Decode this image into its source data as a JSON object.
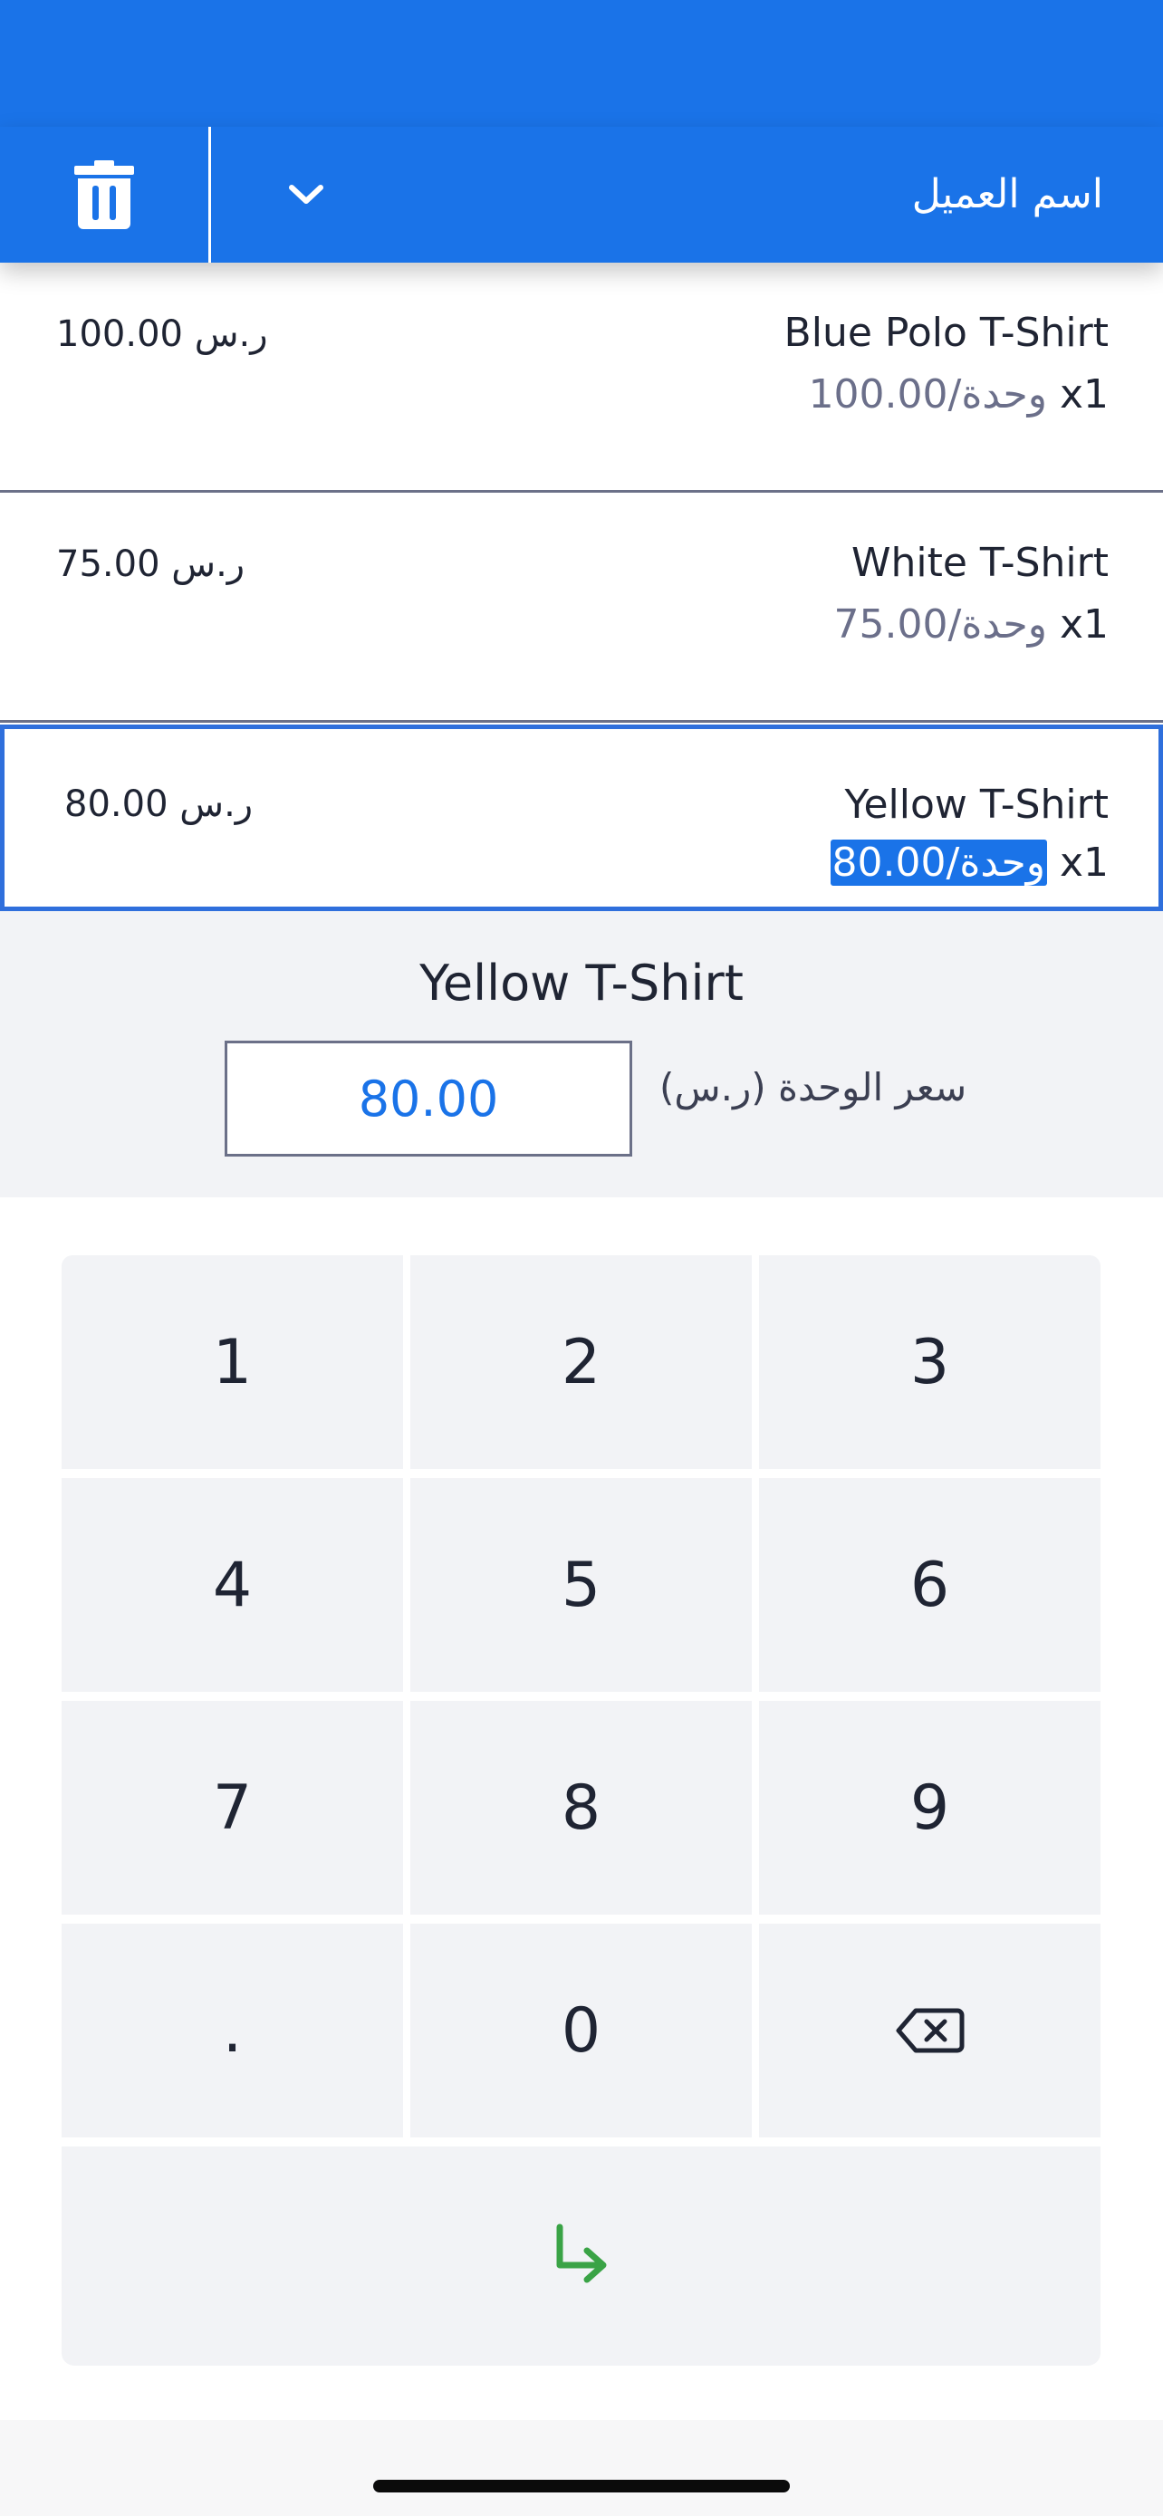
{
  "header": {
    "customer_name_placeholder": "اسم العميل",
    "trash_icon": "trash-icon",
    "dropdown_icon": "chevron-down-icon",
    "accent_color": "#1a73e8"
  },
  "cart": {
    "items": [
      {
        "name": "Blue Polo T-Shirt",
        "qty": "x1",
        "unit_price": "100.00/وحدة",
        "total": "100.00 ر.س"
      },
      {
        "name": "White T-Shirt",
        "qty": "x1",
        "unit_price": "75.00/وحدة",
        "total": "75.00 ر.س"
      },
      {
        "name": "Yellow T-Shirt",
        "qty": "x1",
        "unit_price": "80.00/وحدة",
        "total": "80.00 ر.س",
        "selected": true
      }
    ]
  },
  "editor": {
    "title": "Yellow T-Shirt",
    "price_value": "80.00",
    "price_label": "سعر الوحدة (ر.س)"
  },
  "keypad": {
    "keys": [
      "1",
      "2",
      "3",
      "4",
      "5",
      "6",
      "7",
      "8",
      "9",
      ".",
      "0"
    ],
    "backspace_icon": "backspace-icon",
    "enter_icon": "enter-arrow-icon",
    "enter_color": "#3aa346"
  }
}
